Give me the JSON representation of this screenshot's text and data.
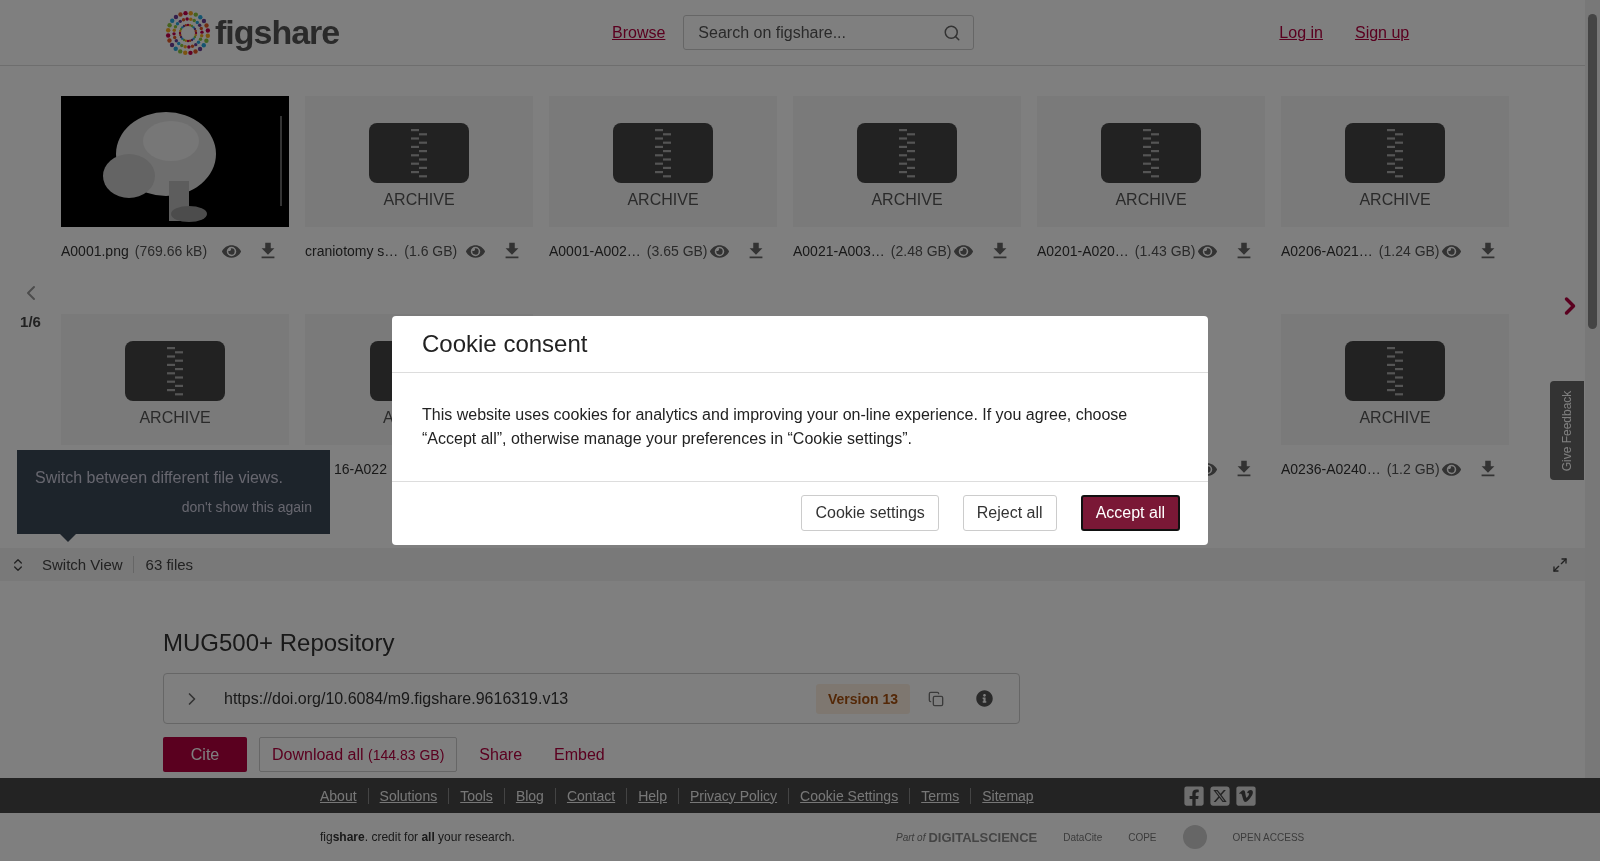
{
  "header": {
    "logo": "figshare",
    "nav": [
      {
        "label": "Browse"
      }
    ],
    "search": {
      "placeholder": "Search on figshare..."
    },
    "auth": [
      {
        "label": "Log in"
      },
      {
        "label": "Sign up"
      }
    ]
  },
  "viewer": {
    "page": "1/6",
    "rows": [
      [
        {
          "kind": "picture",
          "name": "A0001.png",
          "size": "(769.66 kB)"
        },
        {
          "kind": "archive",
          "type_label": "ARCHIVE",
          "name": "craniotomy s…",
          "size": "(1.6 GB)"
        },
        {
          "kind": "archive",
          "type_label": "ARCHIVE",
          "name": "A0001-A002…",
          "size": "(3.65 GB)"
        },
        {
          "kind": "archive",
          "type_label": "ARCHIVE",
          "name": "A0021-A003…",
          "size": "(2.48 GB)"
        },
        {
          "kind": "archive",
          "type_label": "ARCHIVE",
          "name": "A0201-A020…",
          "size": "(1.43 GB)"
        },
        {
          "kind": "archive",
          "type_label": "ARCHIVE",
          "name": "A0206-A021…",
          "size": "(1.24 GB)"
        }
      ],
      [
        {
          "kind": "archive-no-name",
          "type_label": "ARCHIVE"
        },
        {
          "kind": "archive-partial",
          "type_label": "A",
          "name": "16-A022"
        },
        {
          "kind": "hidden"
        },
        {
          "kind": "hidden"
        },
        {
          "kind": "actions-only"
        },
        {
          "kind": "archive",
          "type_label": "ARCHIVE",
          "name": "A0236-A0240…",
          "size": "(1.2 GB)"
        }
      ]
    ],
    "switch_view": "Switch View",
    "file_count": "63 files"
  },
  "tooltip": {
    "text": "Switch between different file views.",
    "dismiss": "don't show this again"
  },
  "item": {
    "title": "MUG500+ Repository",
    "doi": "https://doi.org/10.6084/m9.figshare.9616319.v13",
    "version": "Version 13",
    "actions": [
      {
        "kind": "primary",
        "label": "Cite"
      },
      {
        "kind": "outline",
        "label": "Download all",
        "detail": "(144.83 GB)"
      },
      {
        "kind": "link",
        "label": "Share"
      },
      {
        "kind": "link",
        "label": "Embed"
      }
    ]
  },
  "feedback": "Give Feedback",
  "footer": {
    "links": [
      "About",
      "Solutions",
      "Tools",
      "Blog",
      "Contact",
      "Help",
      "Privacy Policy",
      "Cookie Settings",
      "Terms",
      "Sitemap"
    ],
    "tagline": "fig**share**. credit for **all** your research.",
    "partners": [
      {
        "kind": "digital-science",
        "prefix": "Part of",
        "label": "DIGITALSCIENCE"
      },
      {
        "kind": "datacite",
        "label": "DataCite"
      },
      {
        "kind": "cope",
        "label": "COPE"
      },
      {
        "kind": "seal"
      },
      {
        "kind": "open-access",
        "label": "OPEN ACCESS"
      }
    ]
  },
  "cookie": {
    "title": "Cookie consent",
    "body": "This website uses cookies for analytics and improving your on-line experience. If you agree, choose “Accept all”, otherwise manage your preferences in “Cookie settings”.",
    "buttons": [
      {
        "kind": "outline",
        "label": "Cookie settings"
      },
      {
        "kind": "outline",
        "label": "Reject all"
      },
      {
        "kind": "primary",
        "label": "Accept all"
      }
    ]
  }
}
